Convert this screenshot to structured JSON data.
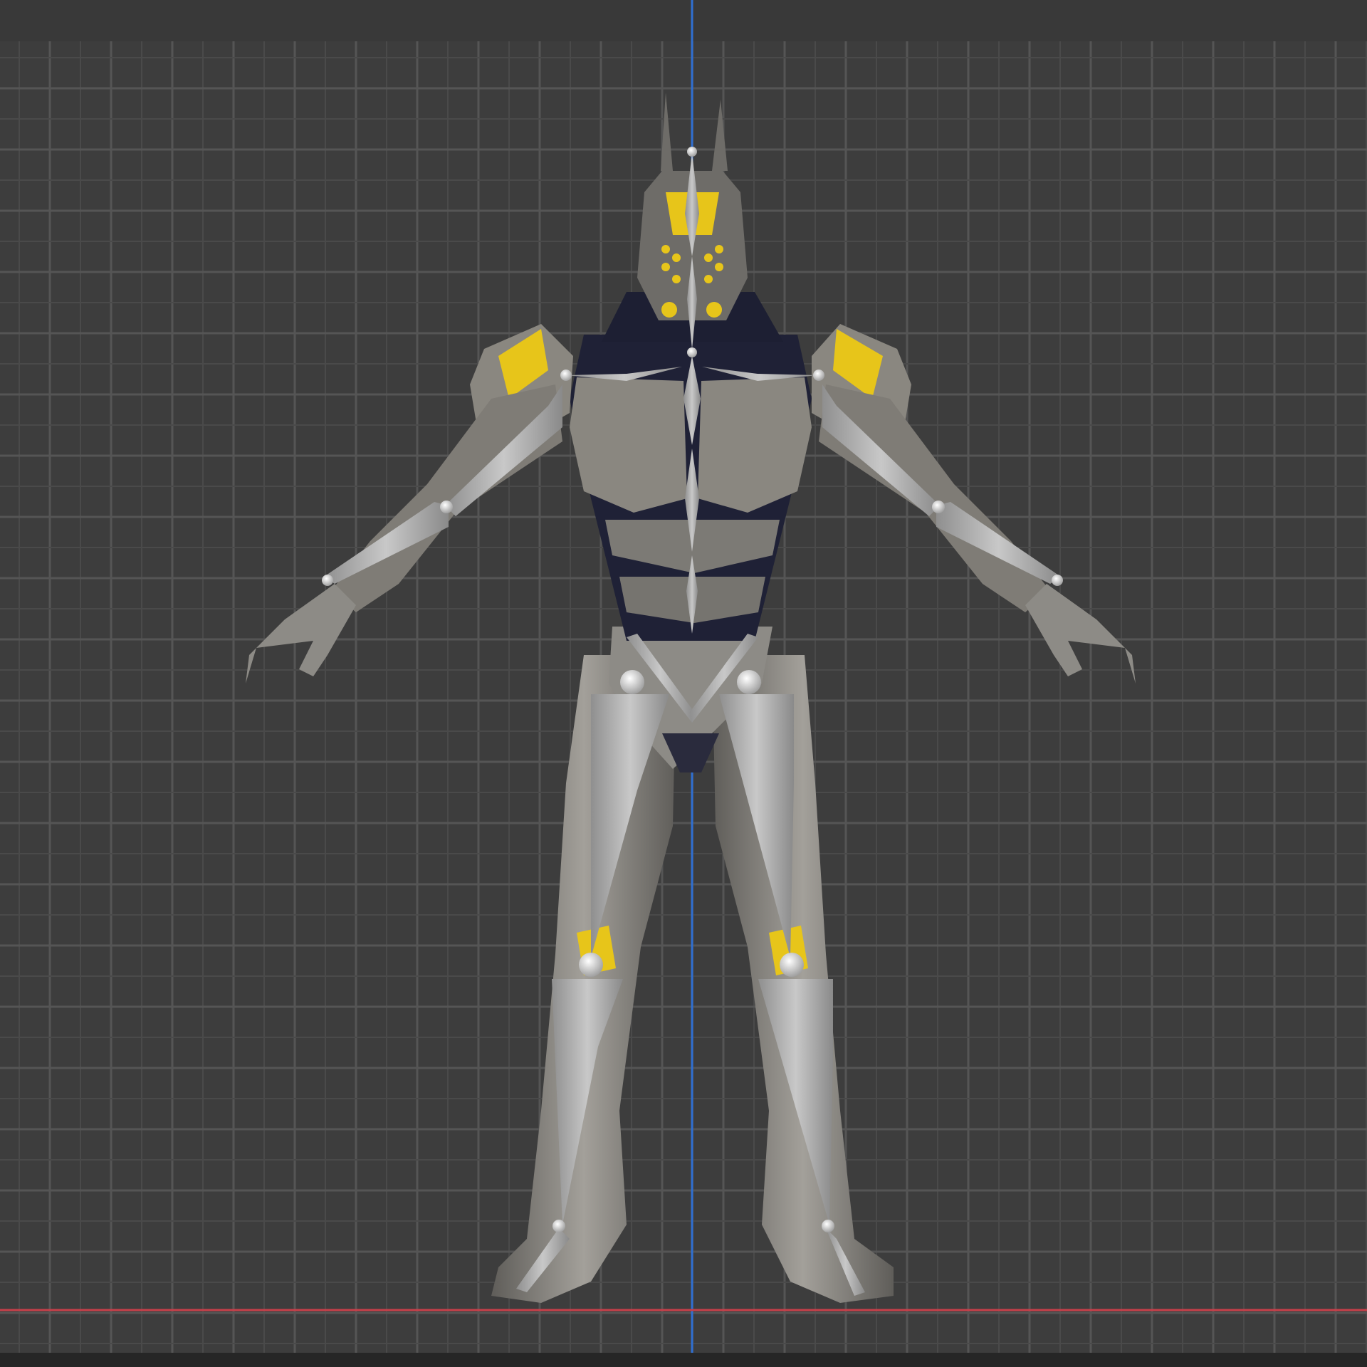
{
  "viewport": {
    "mode": "front-orthographic",
    "background": "#3d3d3d",
    "grid_minor_color": "#4a4a4a",
    "grid_major_color": "#555555",
    "z_axis_color": "#2f6fd1",
    "x_axis_color": "#c7404a"
  },
  "model": {
    "name": "armored-robot-character",
    "armor_color": "#8d8b86",
    "accent_color": "#e7c51a",
    "undersuit_color": "#1f2136",
    "bone_color": "#b4b4b4",
    "joint_color": "#d9d9d9"
  }
}
